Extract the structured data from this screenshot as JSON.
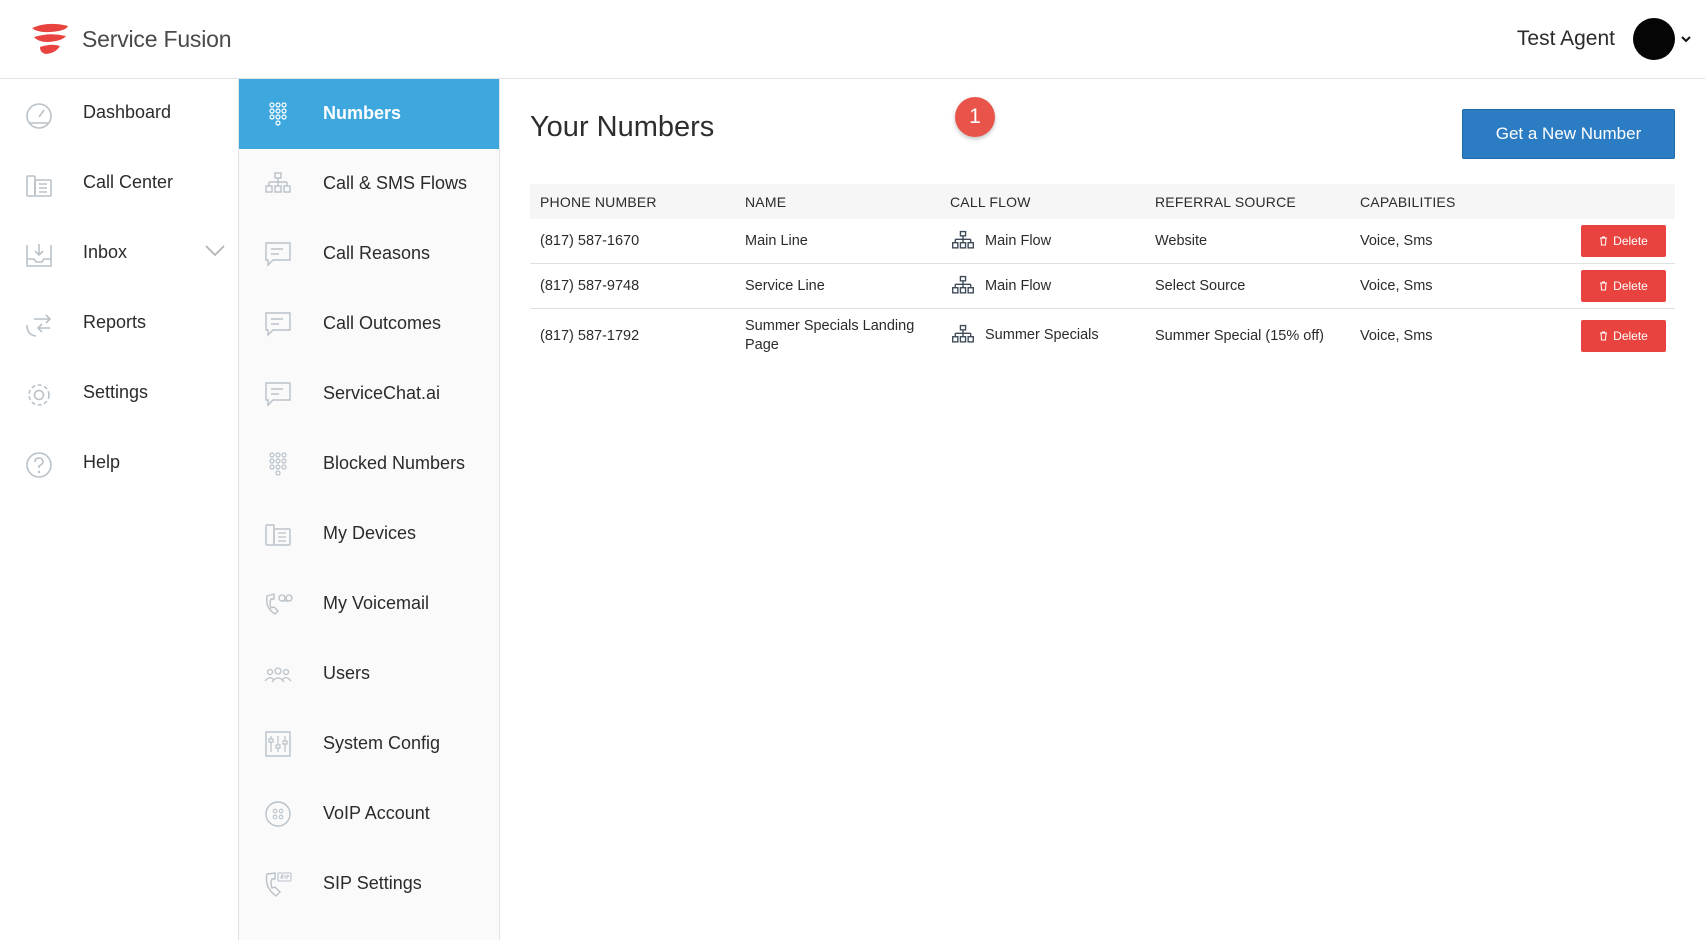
{
  "app": {
    "name": "Service Fusion",
    "user_name": "Test Agent"
  },
  "sidebar": {
    "items": [
      {
        "label": "Dashboard",
        "icon": "dashboard-icon"
      },
      {
        "label": "Call Center",
        "icon": "call-center-icon"
      },
      {
        "label": "Inbox",
        "icon": "inbox-icon",
        "expandable": true
      },
      {
        "label": "Reports",
        "icon": "reports-icon"
      },
      {
        "label": "Settings",
        "icon": "gear-icon"
      },
      {
        "label": "Help",
        "icon": "help-icon"
      }
    ]
  },
  "subnav": {
    "items": [
      {
        "label": "Numbers",
        "icon": "keypad-icon",
        "active": true
      },
      {
        "label": "Call & SMS Flows",
        "icon": "flow-icon"
      },
      {
        "label": "Call Reasons",
        "icon": "chat-icon"
      },
      {
        "label": "Call Outcomes",
        "icon": "chat-icon"
      },
      {
        "label": "ServiceChat.ai",
        "icon": "chat-icon"
      },
      {
        "label": "Blocked Numbers",
        "icon": "keypad-icon"
      },
      {
        "label": "My Devices",
        "icon": "devices-icon"
      },
      {
        "label": "My Voicemail",
        "icon": "voicemail-icon"
      },
      {
        "label": "Users",
        "icon": "users-icon"
      },
      {
        "label": "System Config",
        "icon": "config-icon"
      },
      {
        "label": "VoIP Account",
        "icon": "voip-icon"
      },
      {
        "label": "SIP Settings",
        "icon": "sip-icon"
      }
    ]
  },
  "main": {
    "title": "Your Numbers",
    "badge": "1",
    "new_number_label": "Get a New Number",
    "table": {
      "headers": [
        "PHONE NUMBER",
        "NAME",
        "CALL FLOW",
        "REFERRAL SOURCE",
        "CAPABILITIES"
      ],
      "delete_label": "Delete",
      "rows": [
        {
          "phone": "(817) 587-1670",
          "name": "Main Line",
          "flow": "Main Flow",
          "referral": "Website",
          "capabilities": "Voice, Sms"
        },
        {
          "phone": "(817) 587-9748",
          "name": "Service Line",
          "flow": "Main Flow",
          "referral": "Select Source",
          "capabilities": "Voice, Sms"
        },
        {
          "phone": "(817) 587-1792",
          "name": "Summer Specials Landing Page",
          "flow": "Summer Specials",
          "referral": "Summer Special (15% off)",
          "capabilities": "Voice, Sms"
        }
      ]
    }
  },
  "colors": {
    "accent": "#3ea8de",
    "primary_button": "#2b7cc3",
    "danger": "#e8433f",
    "badge": "#e9544a",
    "logo": "#e8433f"
  }
}
